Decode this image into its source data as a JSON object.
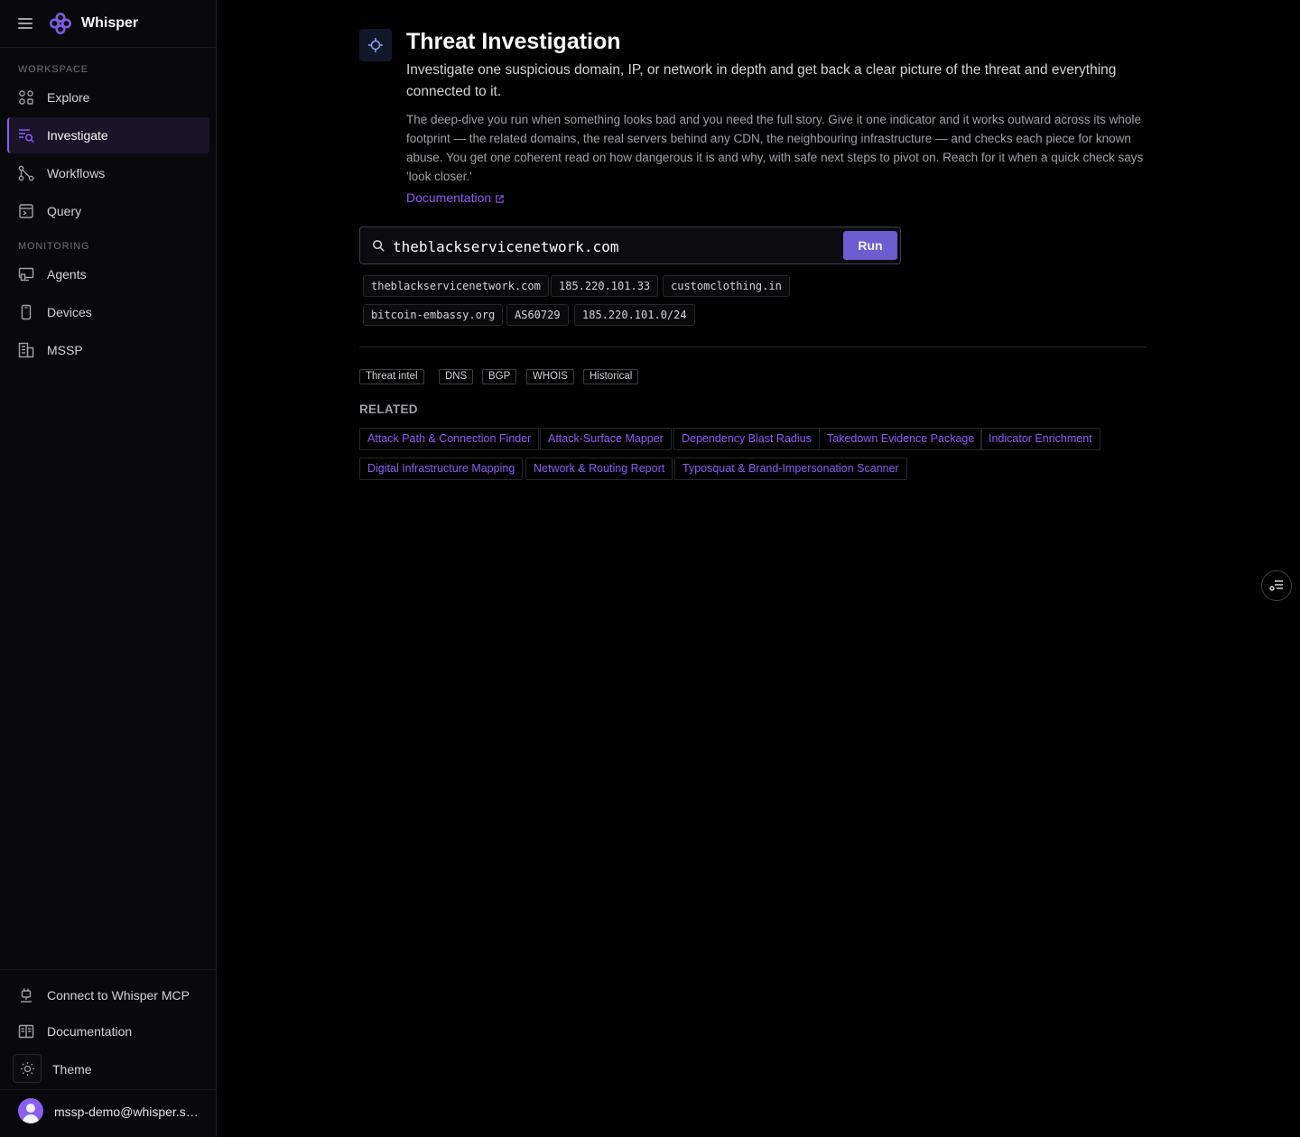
{
  "app": {
    "brand": "Whisper"
  },
  "sidebar": {
    "workspace_label": "WORKSPACE",
    "monitoring_label": "MONITORING",
    "workspace_items": [
      {
        "label": "Explore",
        "icon": "explore-icon"
      },
      {
        "label": "Investigate",
        "icon": "investigate-icon",
        "active": true
      },
      {
        "label": "Workflows",
        "icon": "workflows-icon"
      },
      {
        "label": "Query",
        "icon": "query-icon"
      }
    ],
    "monitoring_items": [
      {
        "label": "Agents",
        "icon": "agents-icon"
      },
      {
        "label": "Devices",
        "icon": "devices-icon"
      },
      {
        "label": "MSSP",
        "icon": "mssp-icon"
      }
    ],
    "bottom": {
      "mcp_label": "Connect to Whisper MCP",
      "docs_label": "Documentation",
      "theme_label": "Theme",
      "user_email": "mssp-demo@whisper.security"
    }
  },
  "main": {
    "title": "Threat Investigation",
    "subtitle": "Investigate one suspicious domain, IP, or network in depth and get back a clear picture of the threat and everything connected to it.",
    "description": "The deep-dive you run when something looks bad and you need the full story. Give it one indicator and it works outward across its whole footprint — the related domains, the real servers behind any CDN, the neighbouring infrastructure — and checks each piece for known abuse. You get one coherent read on how dangerous it is and why, with safe next steps to pivot on. Reach for it when a quick check says 'look closer.'",
    "doc_link": "Documentation",
    "search": {
      "value": "theblackservicenetwork.com",
      "run_label": "Run"
    },
    "examples": [
      "theblackservicenetwork.com",
      "185.220.101.33",
      "customclothing.in",
      "bitcoin-embassy.org",
      "AS60729",
      "185.220.101.0/24"
    ],
    "tags": [
      "Threat intel",
      "DNS",
      "BGP",
      "WHOIS",
      "Historical"
    ],
    "related_label": "RELATED",
    "related": [
      "Attack Path & Connection Finder",
      "Attack-Surface Mapper",
      "Dependency Blast Radius",
      "Takedown Evidence Package",
      "Indicator Enrichment",
      "Digital Infrastructure Mapping",
      "Network & Routing Report",
      "Typosquat & Brand-Impersonation Scanner"
    ]
  },
  "colors": {
    "accent": "#8b5cf6",
    "run_button": "#6d5bd0",
    "background": "#000000",
    "sidebar": "#09090b"
  }
}
